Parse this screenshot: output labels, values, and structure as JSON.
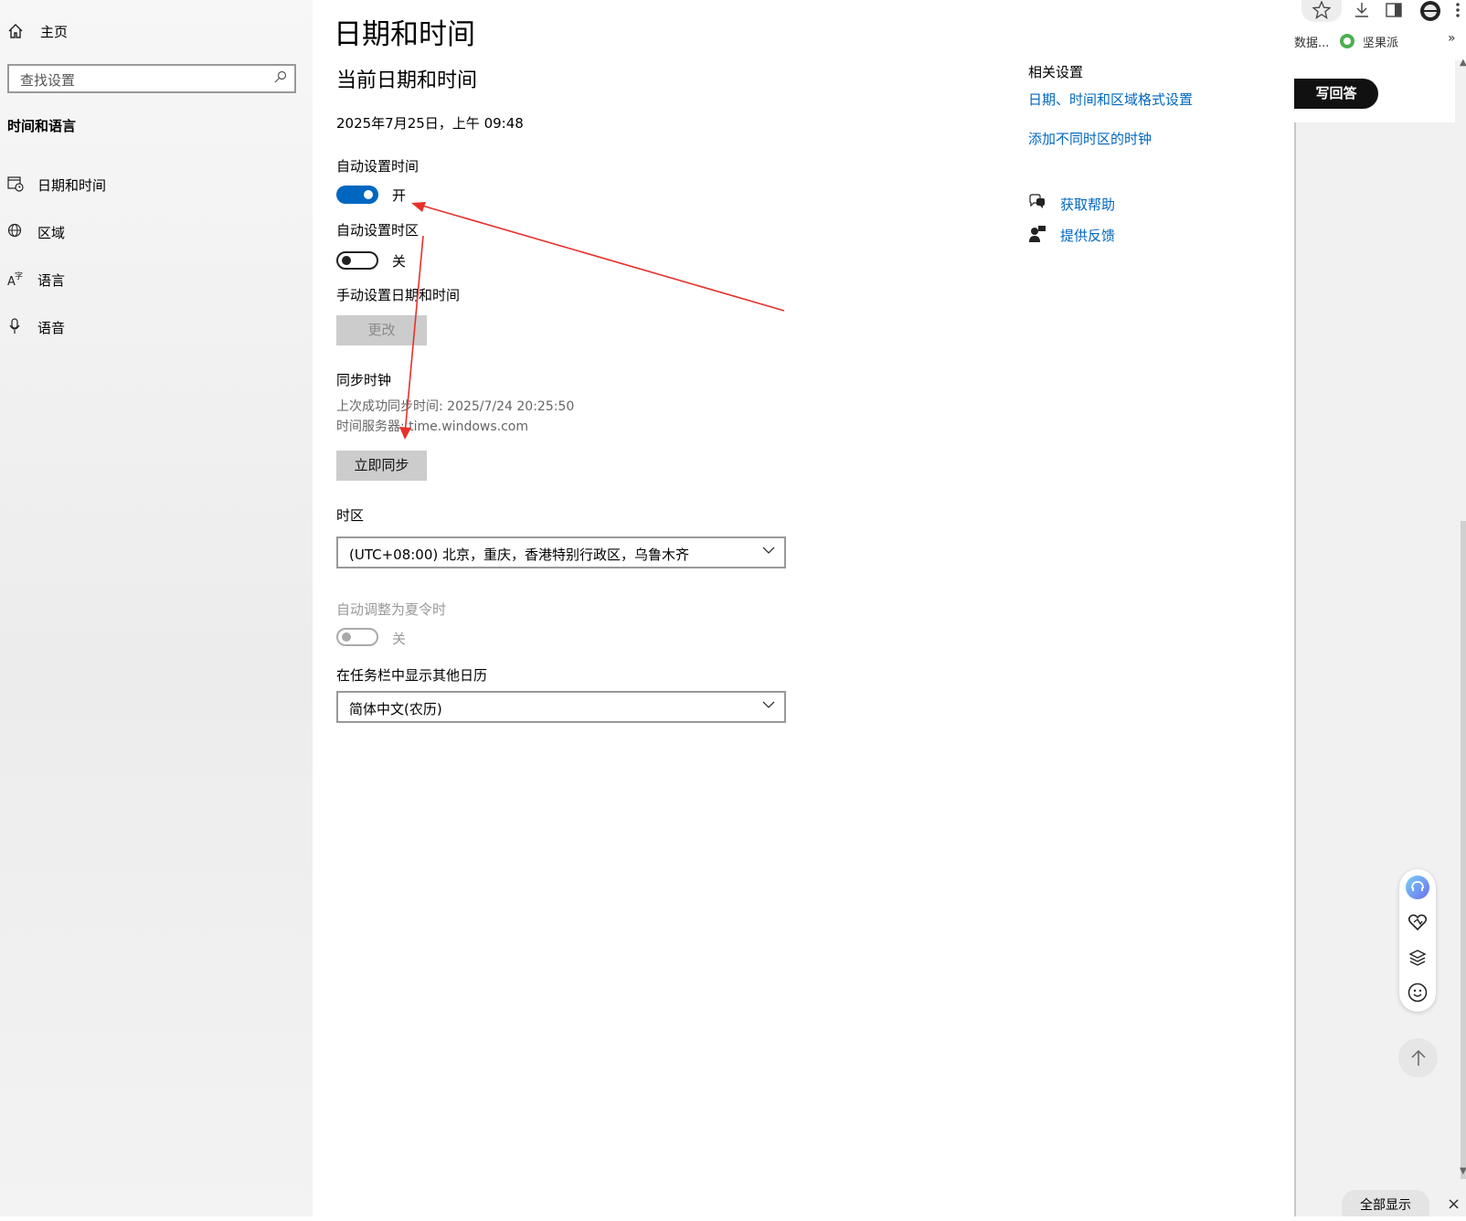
{
  "nav": {
    "home_label": "主页",
    "search_placeholder": "查找设置",
    "section_title": "时间和语言",
    "items": [
      {
        "label": "日期和时间",
        "icon": "calendar-clock-icon"
      },
      {
        "label": "区域",
        "icon": "globe-icon"
      },
      {
        "label": "语言",
        "icon": "language-icon"
      },
      {
        "label": "语音",
        "icon": "microphone-icon"
      }
    ]
  },
  "main": {
    "title": "日期和时间",
    "current_heading": "当前日期和时间",
    "current_datetime": "2025年7月25日，上午 09:48",
    "auto_time": {
      "label": "自动设置时间",
      "state": "开",
      "on": true
    },
    "auto_timezone": {
      "label": "自动设置时区",
      "state": "关",
      "on": false
    },
    "manual": {
      "label": "手动设置日期和时间",
      "button": "更改"
    },
    "sync": {
      "heading": "同步时钟",
      "last_sync": "上次成功同步时间: 2025/7/24 20:25:50",
      "server": "时间服务器: time.windows.com",
      "button": "立即同步"
    },
    "timezone": {
      "label": "时区",
      "value": "(UTC+08:00) 北京，重庆，香港特别行政区，乌鲁木齐"
    },
    "dst": {
      "label": "自动调整为夏令时",
      "state": "关",
      "on": false,
      "disabled": true
    },
    "calendar": {
      "label": "在任务栏中显示其他日历",
      "value": "简体中文(农历)"
    }
  },
  "related": {
    "heading": "相关设置",
    "links": [
      "日期、时间和区域格式设置",
      "添加不同时区的时钟"
    ],
    "help": "获取帮助",
    "feedback": "提供反馈"
  },
  "browser": {
    "bookmark_1": "数据...",
    "bookmark_2": "坚果派",
    "more_bookmarks": "»",
    "write_answer": "写回答",
    "show_all": "全部显示",
    "close": "×"
  },
  "colors": {
    "accent": "#0067c0",
    "annotation_arrow": "#e8302a"
  }
}
